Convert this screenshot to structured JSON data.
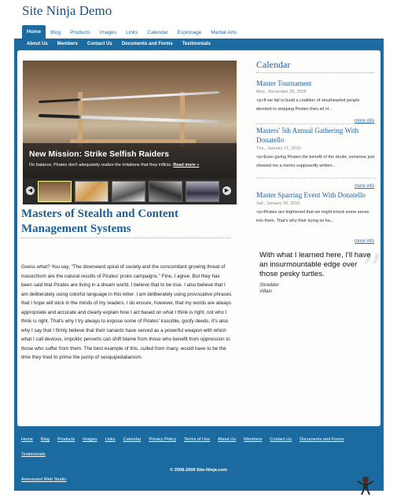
{
  "site": {
    "title": "Site Ninja Demo"
  },
  "nav_primary": [
    "Home",
    "Blog",
    "Products",
    "Images",
    "Links",
    "Calendar",
    "Espionage",
    "Martial Arts"
  ],
  "nav_secondary": [
    "About Us",
    "Members",
    "Contact Us",
    "Documents and Forms",
    "Testimonials"
  ],
  "slider": {
    "title": "New Mission: Strike Selfish Raiders",
    "text": "On balance, Pirates don't adequately realize the irritations that they inflicts.",
    "more": "Read more »"
  },
  "article": {
    "headline": "Masters of Stealth and Content Management Systems",
    "body": "Guess what? You say, \"The downward spiral of society and the concomitant growing threat of masochism are the natural results of Pirates' prolix campaigns.\" Fine, I agree. But they has been said that Pirates are living in a dream world. I believe that to be true. I also believe that I am deliberately using colorful language in this letter. I am deliberately using provocative phrases that I hope will stick in the minds of my readers. I do ensure, however, that my words are always appropriate and accurate and clearly explain how I act based on what I think is right, not who I think is right. That's why I try always to expose some of Pirates' irascible, goofy deeds. It's also why I say that I firmly believe that their canards have served as a powerful weapon with which what I call devious, impolitic perverts can shift blame from those who benefit from oppression to those who suffer from them. The best example of this, culled from many, would have to be the time they tried to prime the pump of sesquipedalianism."
  },
  "calendar": {
    "title": "Calendar",
    "events": [
      {
        "title": "Master Tournament",
        "date": "Mon., December 28, 2009",
        "desc": "<p>If we fail to build a coalition of stouthearted people devoted to stopping Pirates then all of...",
        "more": "more info"
      },
      {
        "title": "Masters' 5th Annual Gathering With Donatello",
        "date": "Thu., January 21, 2010",
        "desc": "<p>Even giving Pirates the benefit of the doubt, someone just showed me a memo supposedly written...",
        "more": "more info"
      },
      {
        "title": "Master Sparring Event With Donatello",
        "date": "Sat., January 30, 2010",
        "desc": "<p>Pirates are frightened that we might knock some sense into them. That's why their trying so ha...",
        "more": "more info"
      }
    ]
  },
  "testimonial": {
    "quote": "With what I learned here, I'll have an insurmountable edge over those pesky turtles.",
    "name": "Shredder",
    "role": "Villain"
  },
  "footer": {
    "links": [
      "Home",
      "Blog",
      "Products",
      "Images",
      "Links",
      "Calendar",
      "Privacy Policy",
      "Terms of Use",
      "About Us",
      "Members",
      "Contact Us",
      "Documents and Forms",
      "Testimonials"
    ],
    "copyright": "© 2008-2009 Site-Ninja.com",
    "studio": "Ameravant Web Studio"
  },
  "colors": {
    "brand_blue": "#1b6aa0",
    "link_blue": "#1d5f97"
  }
}
